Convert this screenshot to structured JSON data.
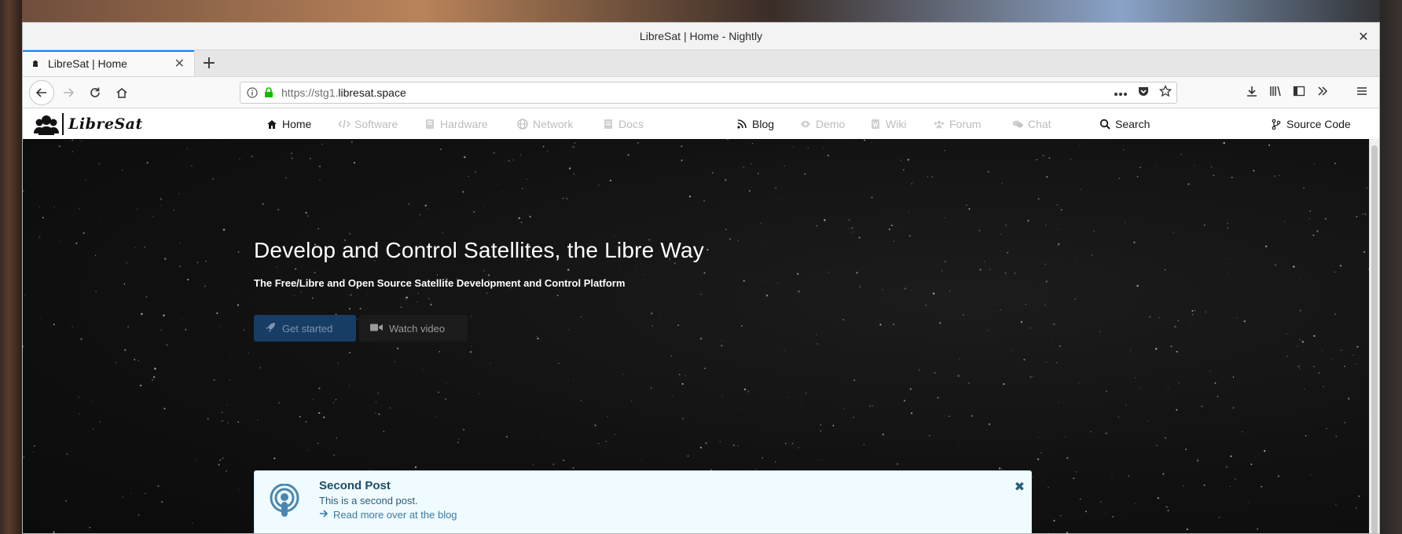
{
  "window": {
    "title": "LibreSat | Home - Nightly"
  },
  "tab": {
    "label": "LibreSat | Home"
  },
  "urlbar": {
    "url_prefix": "https://stg1.",
    "url_domain": "libresat.space"
  },
  "site": {
    "brand": "LibreSat",
    "nav": {
      "home": "Home",
      "software": "Software",
      "hardware": "Hardware",
      "network": "Network",
      "docs": "Docs",
      "blog": "Blog",
      "demo": "Demo",
      "wiki": "Wiki",
      "forum": "Forum",
      "chat": "Chat",
      "search": "Search",
      "source": "Source Code"
    }
  },
  "hero": {
    "title": "Develop and Control Satellites, the Libre Way",
    "subtitle": "The Free/Libre and Open Source Satellite Development and Control Platform",
    "get_started": "Get started",
    "watch_video": "Watch video"
  },
  "post": {
    "title": "Second Post",
    "body": "This is a second post.",
    "link": "Read more over at the blog"
  }
}
